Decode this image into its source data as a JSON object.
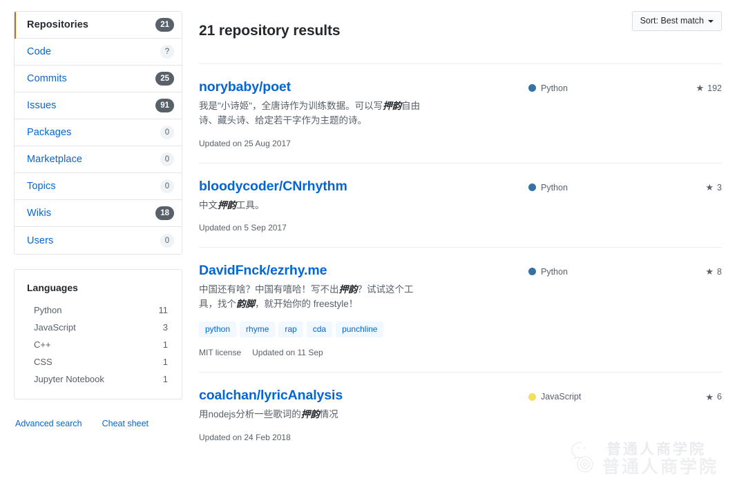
{
  "sidebar": {
    "nav_items": [
      {
        "label": "Repositories",
        "count": "21",
        "active": true,
        "muted": false
      },
      {
        "label": "Code",
        "count": "?",
        "active": false,
        "muted": true
      },
      {
        "label": "Commits",
        "count": "25",
        "active": false,
        "muted": false
      },
      {
        "label": "Issues",
        "count": "91",
        "active": false,
        "muted": false
      },
      {
        "label": "Packages",
        "count": "0",
        "active": false,
        "muted": true
      },
      {
        "label": "Marketplace",
        "count": "0",
        "active": false,
        "muted": true
      },
      {
        "label": "Topics",
        "count": "0",
        "active": false,
        "muted": true
      },
      {
        "label": "Wikis",
        "count": "18",
        "active": false,
        "muted": false
      },
      {
        "label": "Users",
        "count": "0",
        "active": false,
        "muted": true
      }
    ],
    "languages": {
      "title": "Languages",
      "rows": [
        {
          "name": "Python",
          "count": "11"
        },
        {
          "name": "JavaScript",
          "count": "3"
        },
        {
          "name": "C++",
          "count": "1"
        },
        {
          "name": "CSS",
          "count": "1"
        },
        {
          "name": "Jupyter Notebook",
          "count": "1"
        }
      ]
    },
    "footer_links": [
      {
        "label": "Advanced search"
      },
      {
        "label": "Cheat sheet"
      }
    ]
  },
  "main": {
    "results_title": "21 repository results",
    "sort_label": "Sort: Best match",
    "results": [
      {
        "title": "norybaby/poet",
        "desc_parts": [
          {
            "text": "我是\"小诗姬\"，全唐诗作为训练数据。可以写",
            "em": false
          },
          {
            "text": "押韵",
            "em": true
          },
          {
            "text": "自由诗、藏头诗、给定若干字作为主题的诗。",
            "em": false
          }
        ],
        "topics": [],
        "license": "",
        "updated": "Updated on 25 Aug 2017",
        "language": "Python",
        "language_color": "#3572A5",
        "stars": "192"
      },
      {
        "title": "bloodycoder/CNrhythm",
        "desc_parts": [
          {
            "text": "中文",
            "em": false
          },
          {
            "text": "押韵",
            "em": true
          },
          {
            "text": "工具。",
            "em": false
          }
        ],
        "topics": [],
        "license": "",
        "updated": "Updated on 5 Sep 2017",
        "language": "Python",
        "language_color": "#3572A5",
        "stars": "3"
      },
      {
        "title": "DavidFnck/ezrhy.me",
        "desc_parts": [
          {
            "text": "中国还有啥？中国有嘻哈！写不出",
            "em": false
          },
          {
            "text": "押韵",
            "em": true
          },
          {
            "text": "？试试这个工具，找个",
            "em": false
          },
          {
            "text": "韵脚",
            "em": true
          },
          {
            "text": "，就开始你的 freestyle！",
            "em": false
          }
        ],
        "topics": [
          "python",
          "rhyme",
          "rap",
          "cda",
          "punchline"
        ],
        "license": "MIT license",
        "updated": "Updated on 11 Sep",
        "language": "Python",
        "language_color": "#3572A5",
        "stars": "8"
      },
      {
        "title": "coalchan/lyricAnalysis",
        "desc_parts": [
          {
            "text": "用nodejs分析一些歌词的",
            "em": false
          },
          {
            "text": "押韵",
            "em": true
          },
          {
            "text": "情况",
            "em": false
          }
        ],
        "topics": [],
        "license": "",
        "updated": "Updated on 24 Feb 2018",
        "language": "JavaScript",
        "language_color": "#f1e05a",
        "stars": "6"
      }
    ]
  },
  "watermark": {
    "line1": "普通人商学院",
    "line2": "普通人商学院"
  },
  "icons": {
    "star": "★",
    "chevron_down": "chevron-down-icon"
  }
}
